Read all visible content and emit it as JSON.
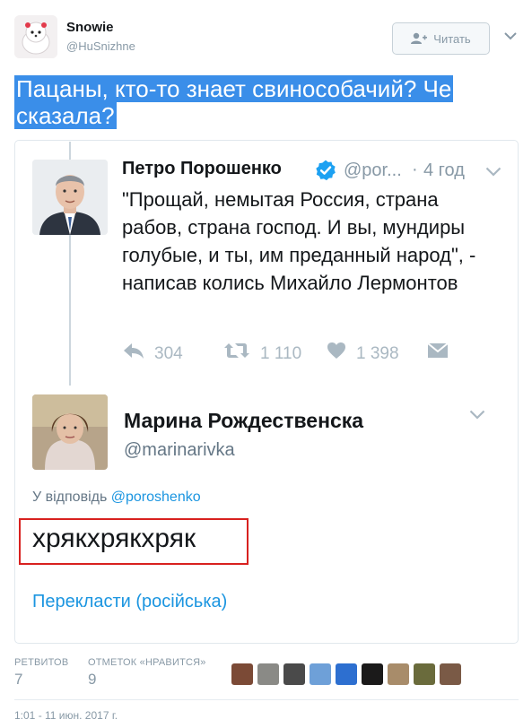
{
  "header": {
    "display_name": "Snowie",
    "handle": "@HuSnizhne",
    "follow_label": "Читать"
  },
  "tweet": {
    "text": "Пацаны, кто-то знает свинособачий? Че сказала?"
  },
  "quoted_tweet": {
    "author_name": "Петро Порошенко",
    "author_handle": "@por...",
    "dot": "·",
    "time": "4 год",
    "text": "\"Прощай, немытая Россия, страна рабов, страна господ. И вы, мундиры голубые, и ты, им преданный народ\", - написав колись Михайло Лермонтов",
    "replies_count": "304",
    "retweets_count": "1 110",
    "likes_count": "1 398"
  },
  "reply_tweet": {
    "author_name": "Марина Рождественска",
    "author_handle": "@marinarivka",
    "reply_prefix": "У відповідь",
    "reply_to_handle": "@poroshenko",
    "text": "хрякхрякхряк",
    "translate_label": "Перекласти (російська)"
  },
  "stats": {
    "retweets_label": "РЕТВИТОВ",
    "retweets_value": "7",
    "likes_label": "ОТМЕТОК «НРАВИТСЯ»",
    "likes_value": "9"
  },
  "liker_avatars": [
    "#7b4a36",
    "#8a8a86",
    "#4a4a4a",
    "#6ea0d8",
    "#2d6fd0",
    "#1b1a1a",
    "#a88c6a",
    "#6a6b3c",
    "#7a5a46"
  ],
  "footer": {
    "timestamp": "1:01 - 11 июн. 2017 г."
  },
  "colors": {
    "highlight": "#3a8ee9",
    "link": "#1b95e0",
    "verified": "#1da1f2",
    "red_box": "#d8211f"
  }
}
